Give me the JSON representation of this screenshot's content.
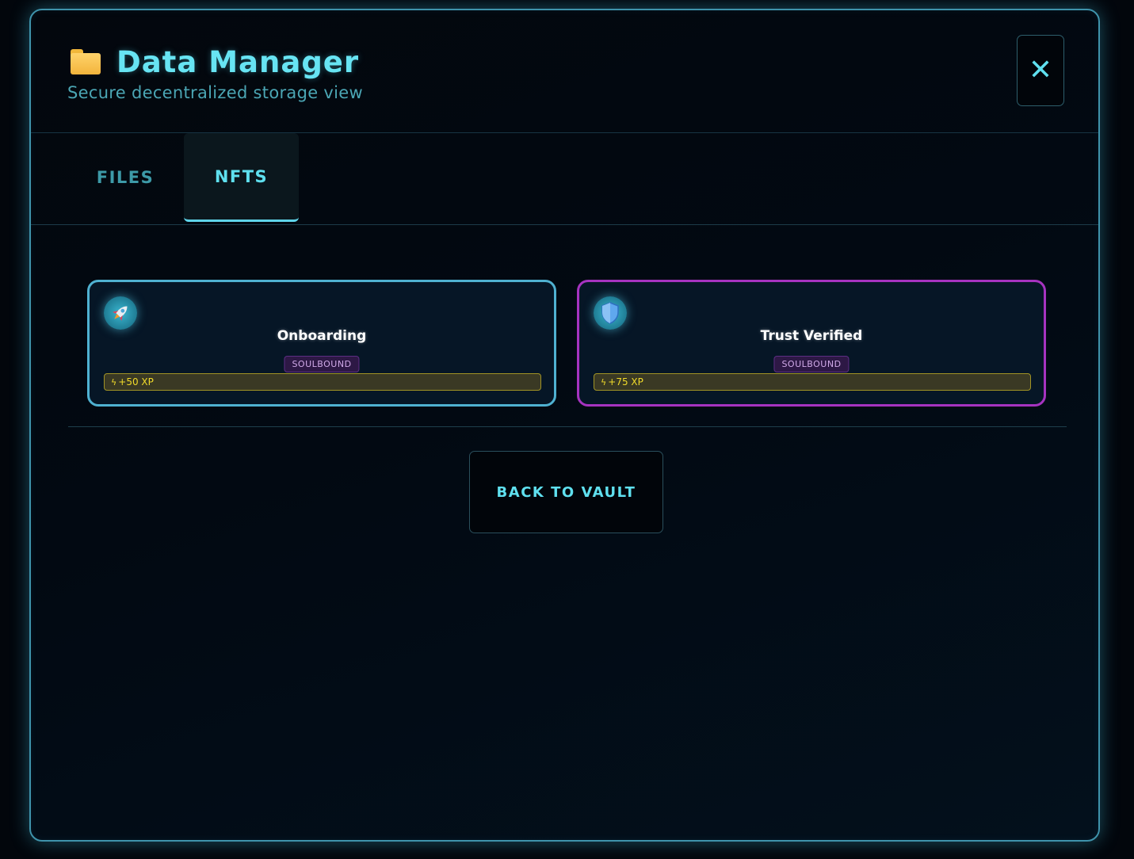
{
  "header": {
    "title": "Data Manager",
    "subtitle": "Secure decentralized storage view",
    "icon": "folder-icon",
    "close_label": "✕"
  },
  "tabs": [
    {
      "label": "FILES",
      "active": false
    },
    {
      "label": "NFTS",
      "active": true
    }
  ],
  "nfts": [
    {
      "name": "Onboarding",
      "icon": "rocket-icon",
      "badge": "SOULBOUND",
      "xp": "+50 XP",
      "border_color": "#4fb1d1"
    },
    {
      "name": "Trust Verified",
      "icon": "shield-icon",
      "badge": "SOULBOUND",
      "xp": "+75 XP",
      "border_color": "#a633c0"
    }
  ],
  "footer": {
    "back_label": "BACK TO VAULT"
  },
  "colors": {
    "accent": "#5fe0ef",
    "modal_border": "#3f93ab",
    "badge_bg": "#2d1845",
    "xp_text": "#f0da2a"
  }
}
